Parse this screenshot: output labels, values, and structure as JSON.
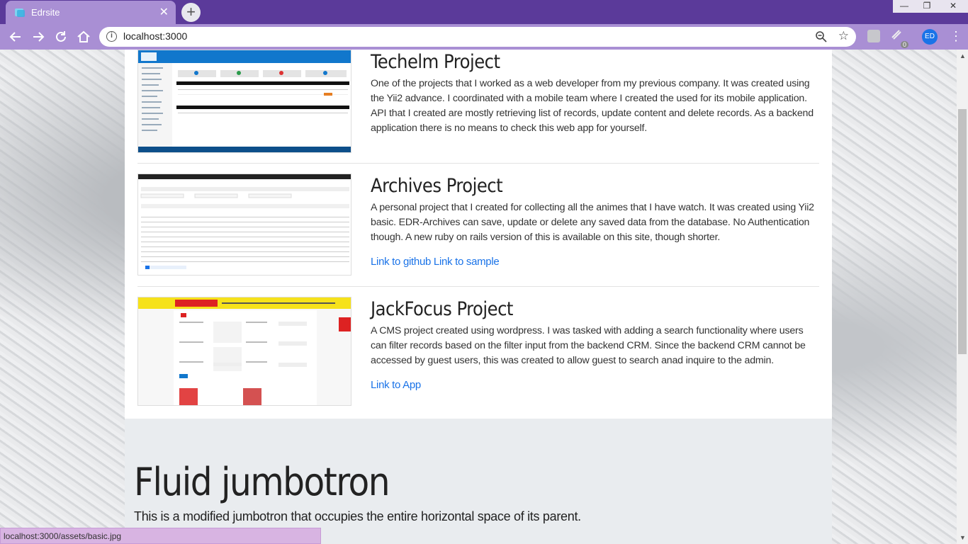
{
  "browser": {
    "tab_title": "Edrsite",
    "url": "localhost:3000",
    "status_url": "localhost:3000/assets/basic.jpg",
    "avatar_initials": "ED",
    "extension_badge": "0"
  },
  "projects": [
    {
      "title": "Techelm Project",
      "description": "One of the projects that I worked as a web developer from my previous company. It was created using the Yii2 advance. I coordinated with a mobile team where I created the used for its mobile application. API that I created are mostly retrieving list of records, update content and delete records. As a backend application there is no means to check this web app for yourself.",
      "links": []
    },
    {
      "title": "Archives Project",
      "description": "A personal project that I created for collecting all the animes that I have watch. It was created using Yii2 basic. EDR-Archives can save, update or delete any saved data from the database. No Authentication though. A new ruby on rails version of this is available on this site, though shorter.",
      "links": [
        "Link to github",
        "Link to sample"
      ]
    },
    {
      "title": "JackFocus Project",
      "description": "A CMS project created using wordpress. I was tasked with adding a search functionality where users can filter records based on the filter input from the backend CRM. Since the backend CRM cannot be accessed by guest users, this was created to allow guest to search anad inquire to the admin.",
      "links": [
        "Link to App"
      ]
    }
  ],
  "jumbotron": {
    "title": "Fluid jumbotron",
    "text": "This is a modified jumbotron that occupies the entire horizontal space of its parent."
  },
  "colors": {
    "titlebar": "#5b3a9a",
    "toolbar": "#a98fd4",
    "link": "#1a73e8",
    "jumbotron_bg": "#e9ecef"
  }
}
